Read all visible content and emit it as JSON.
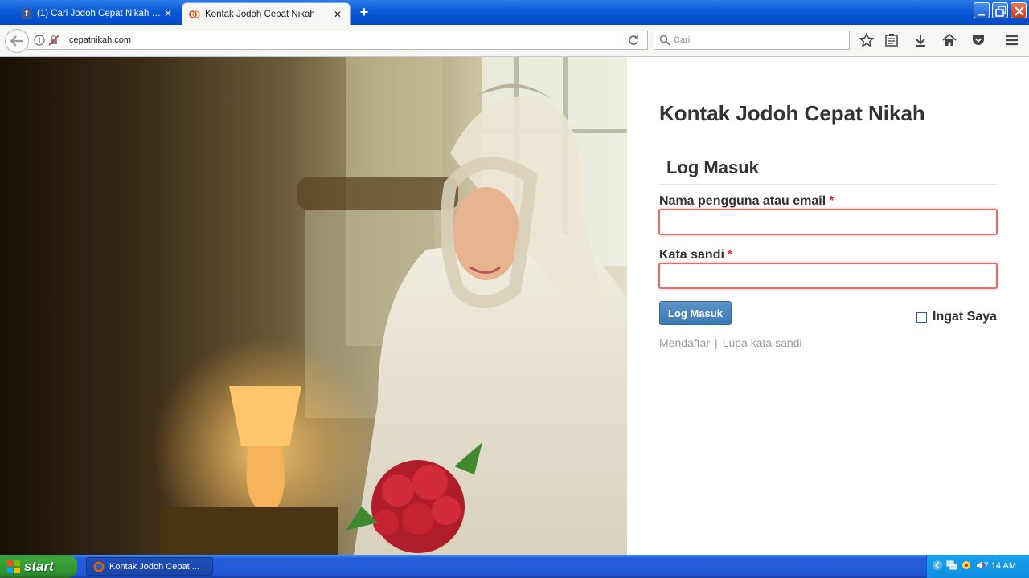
{
  "browser": {
    "tabs": [
      {
        "title": "(1) Cari Jodoh Cepat Nikah - ...",
        "icon": "facebook-icon",
        "active": false
      },
      {
        "title": "Kontak Jodoh Cepat Nikah",
        "icon": "site-favicon",
        "active": true
      }
    ],
    "url": "cepatnikah.com",
    "search_placeholder": "Cari"
  },
  "page": {
    "site_title": "Kontak Jodoh Cepat Nikah",
    "login_heading": "Log Masuk",
    "username_label": "Nama pengguna atau email",
    "password_label": "Kata sandi",
    "required_mark": "*",
    "login_button": "Log Masuk",
    "remember_label": "Ingat Saya",
    "register_link": "Mendaftar",
    "link_separator": "|",
    "lost_password_link": "Lupa kata sandi"
  },
  "taskbar": {
    "start_label": "start",
    "task_item": "Kontak Jodoh Cepat ...",
    "clock": "7:14 AM"
  },
  "colors": {
    "accent_button": "#3f79b3",
    "required": "#d9312c",
    "input_border_error": "#e26a6a"
  }
}
